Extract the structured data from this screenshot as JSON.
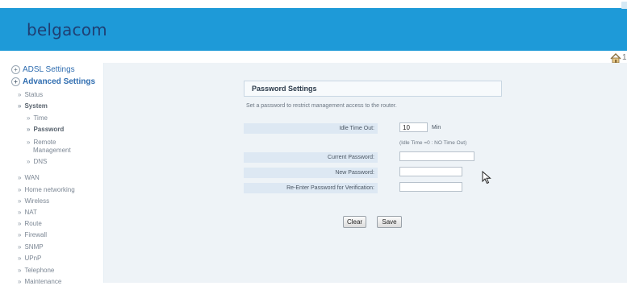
{
  "brand": {
    "logo_text": "belgacom",
    "topbar_color": "#1e9ad8"
  },
  "sidebar": {
    "top_items": [
      {
        "label": "ADSL Settings"
      },
      {
        "label": "Advanced Settings"
      }
    ],
    "items": [
      {
        "label": "Status"
      },
      {
        "label": "System"
      },
      {
        "label": "Time"
      },
      {
        "label": "Password"
      },
      {
        "label": "Remote"
      },
      {
        "label": "Management"
      },
      {
        "label": "DNS"
      },
      {
        "label": "WAN"
      },
      {
        "label": "Home networking"
      },
      {
        "label": "Wireless"
      },
      {
        "label": "NAT"
      },
      {
        "label": "Route"
      },
      {
        "label": "Firewall"
      },
      {
        "label": "SNMP"
      },
      {
        "label": "UPnP"
      },
      {
        "label": "Telephone"
      },
      {
        "label": "Maintenance"
      }
    ]
  },
  "panel": {
    "title": "Password Settings",
    "description": "Set a password to restrict management access to the router."
  },
  "form": {
    "idle_timeout": {
      "label": "Idle Time Out:",
      "value": "10",
      "unit": "Min",
      "hint": "(Idle Time =0 : NO Time Out)"
    },
    "current_password": {
      "label": "Current Password:",
      "value": ""
    },
    "new_password": {
      "label": "New Password:",
      "value": ""
    },
    "reenter_password": {
      "label": "Re-Enter Password for Verification:",
      "value": ""
    }
  },
  "buttons": {
    "clear_label": "Clear",
    "save_label": "Save"
  }
}
